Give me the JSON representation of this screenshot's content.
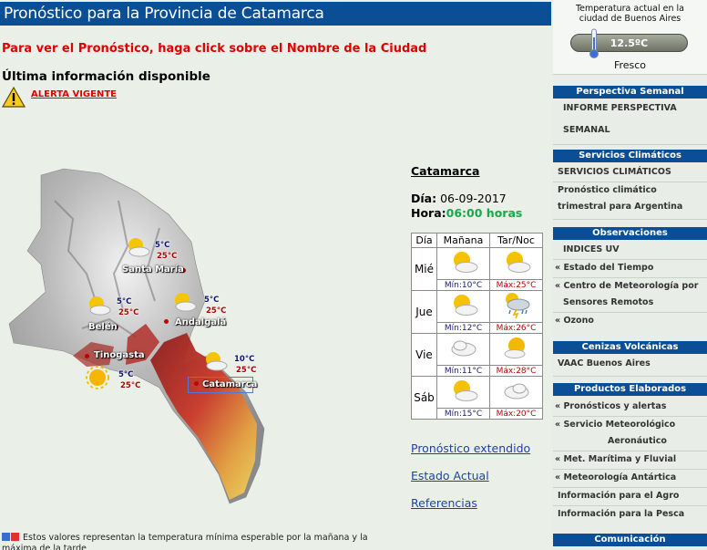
{
  "header": {
    "title": "Pronóstico para la Provincia de Catamarca",
    "instruction": "Para ver el Pronóstico, haga click sobre el Nombre de la Ciudad",
    "ultima": "Última información disponible",
    "alerta": "ALERTA VIGENTE"
  },
  "map": {
    "cities": [
      {
        "name": "Santa María",
        "tmin": "5°C",
        "tmax": "25°C"
      },
      {
        "name": "Belén",
        "tmin": "5°C",
        "tmax": "25°C"
      },
      {
        "name": "Andalgalá",
        "tmin": "5°C",
        "tmax": "25°C"
      },
      {
        "name": "Tinogasta",
        "tmin": "5°C",
        "tmax": "25°C"
      },
      {
        "name": "Catamarca",
        "tmin": "10°C",
        "tmax": "25°C"
      }
    ]
  },
  "forecast": {
    "city": "Catamarca",
    "dia_label": "Día:",
    "dia_value": " 06-09-2017",
    "hora_label": "Hora:",
    "hora_value": "06:00 horas",
    "columns": [
      "Día",
      "Mañana",
      "Tar/Noc"
    ],
    "days": [
      {
        "day": "Mié",
        "manana_icon": "sun-cloud-icon",
        "tarde_icon": "sun-cloud-icon",
        "min": "Mín:10°C",
        "max": "Máx:25°C"
      },
      {
        "day": "Jue",
        "manana_icon": "sun-cloud-icon",
        "tarde_icon": "storm-sun-icon",
        "min": "Mín:12°C",
        "max": "Máx:26°C"
      },
      {
        "day": "Vie",
        "manana_icon": "cloud-icon",
        "tarde_icon": "sun-cloud-icon",
        "min": "Mín:11°C",
        "max": "Máx:28°C"
      },
      {
        "day": "Sáb",
        "manana_icon": "sun-cloud-icon",
        "tarde_icon": "cloud-icon",
        "min": "Mín:15°C",
        "max": "Máx:20°C"
      }
    ],
    "links": [
      "Pronóstico extendido",
      "Estado Actual",
      "Referencias"
    ],
    "footnote": "Estos valores representan la temperatura mínima esperable por la mañana y la máxima de la tarde"
  },
  "sidebar": {
    "current": {
      "title_line1": "Temperatura actual en la",
      "title_line2": "ciudad de Buenos Aires",
      "temp": "12.5ºC",
      "condition": "Fresco"
    },
    "perspectiva": {
      "head": "Perspectiva Semanal",
      "items": [
        "INFORME PERSPECTIVA",
        "SEMANAL"
      ]
    },
    "servicios": {
      "head": "Servicios Climáticos",
      "items": [
        "SERVICIOS CLIMÁTICOS",
        "Pronóstico climático",
        "trimestral para Argentina"
      ]
    },
    "observaciones": {
      "head": "Observaciones",
      "items": [
        "INDICES UV",
        "« Estado del Tiempo",
        "« Centro de Meteorología por",
        "Sensores Remotos",
        "« Ozono"
      ]
    },
    "cenizas": {
      "head": "Cenizas Volcánicas",
      "items": [
        "VAAC Buenos Aires"
      ]
    },
    "productos": {
      "head": "Productos Elaborados",
      "items": [
        "« Pronósticos y alertas",
        "« Servicio Meteorológico",
        "Aeronáutico",
        "« Met. Marítima y Fluvial",
        "« Meteorología Antártica",
        "Información para el Agro",
        "Información para la Pesca"
      ]
    },
    "comunicacion": {
      "head": "Comunicación"
    }
  },
  "colors": {
    "header_blue": "#0a4e96",
    "alert_red": "#e00000",
    "hora_green": "#1aa84a",
    "link_blue": "#1f3fa8",
    "background": "#eaf0e8"
  }
}
